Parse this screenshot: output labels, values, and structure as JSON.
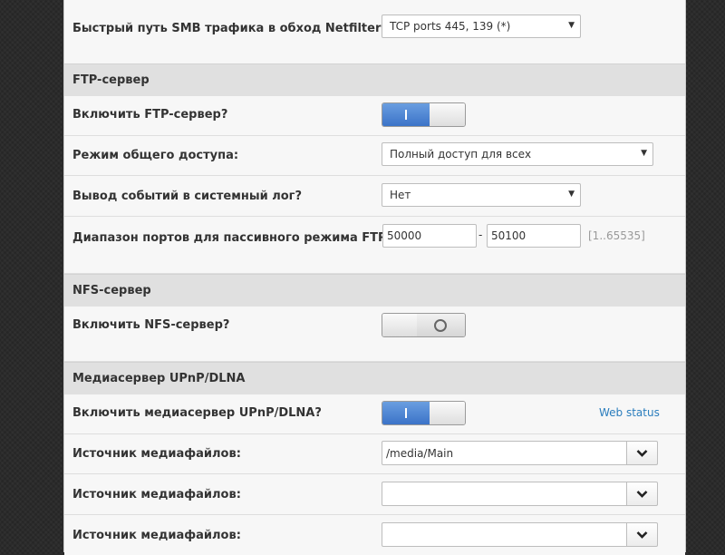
{
  "smb": {
    "fastpath_label": "Быстрый путь SMB трафика в обход Netfilter:",
    "fastpath_value": "TCP ports 445, 139 (*)"
  },
  "ftp": {
    "section_title": "FTP-сервер",
    "enable_label": "Включить FTP-сервер?",
    "enable_state": "on",
    "access_label": "Режим общего доступа:",
    "access_value": "Полный доступ для всех",
    "log_label": "Вывод событий в системный лог?",
    "log_value": "Нет",
    "ports_label": "Диапазон портов для пассивного режима FTP:",
    "port_from": "50000",
    "port_sep": "-",
    "port_to": "50100",
    "port_hint": "[1..65535]"
  },
  "nfs": {
    "section_title": "NFS-сервер",
    "enable_label": "Включить NFS-сервер?",
    "enable_state": "off"
  },
  "dlna": {
    "section_title": "Медиасервер UPnP/DLNA",
    "enable_label": "Включить медиасервер UPnP/DLNA?",
    "enable_state": "on",
    "web_status": "Web status",
    "sources": [
      {
        "label": "Источник медиафайлов:",
        "value": "/media/Main"
      },
      {
        "label": "Источник медиафайлов:",
        "value": ""
      },
      {
        "label": "Источник медиафайлов:",
        "value": ""
      }
    ]
  }
}
